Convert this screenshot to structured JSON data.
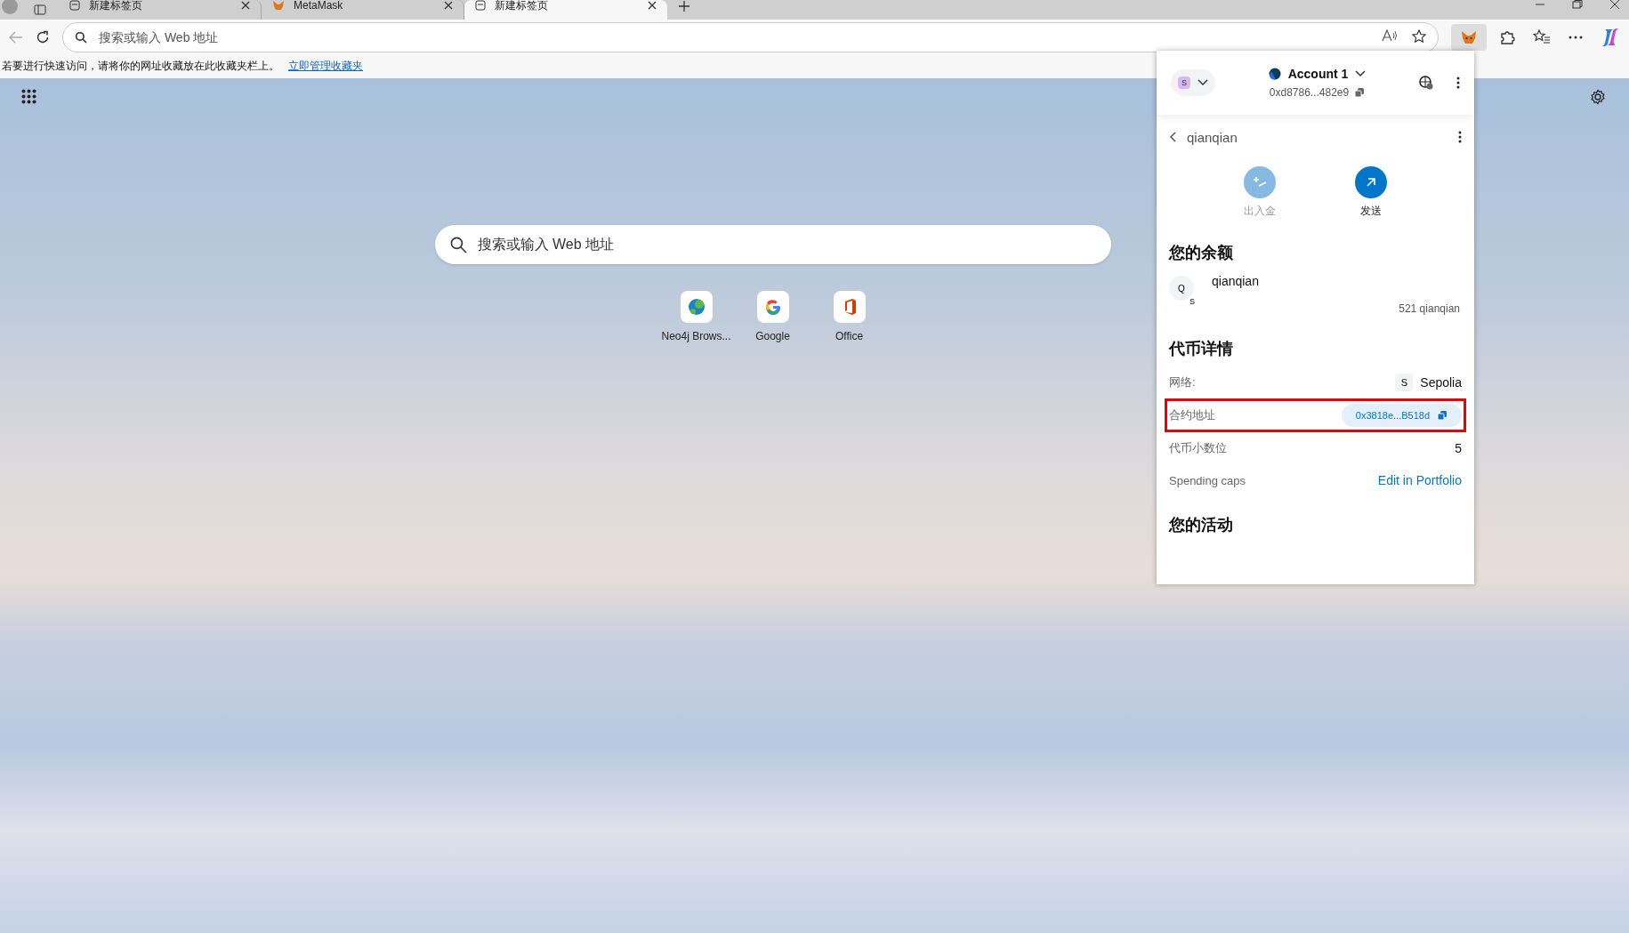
{
  "tabs": [
    {
      "title": "新建标签页",
      "kind": "page",
      "selected": false
    },
    {
      "title": "MetaMask",
      "kind": "metamask",
      "selected": false
    },
    {
      "title": "新建标签页",
      "kind": "page",
      "selected": true
    }
  ],
  "address_bar": {
    "placeholder": "搜索或输入 Web 地址"
  },
  "favorites_hint": {
    "text": "若要进行快速访问，请将你的网址收藏放在此收藏夹栏上。",
    "link": "立即管理收藏夹"
  },
  "new_tab": {
    "search": {
      "placeholder": "搜索或输入 Web 地址"
    },
    "shortcuts": [
      {
        "label": "Neo4j Brows...",
        "kind": "neo4j"
      },
      {
        "label": "Google",
        "kind": "google"
      },
      {
        "label": "Office",
        "kind": "office"
      }
    ]
  },
  "wallet": {
    "network_badge": "S",
    "account": "Account 1",
    "address": "0xd8786...482e9",
    "title": "qianqian",
    "token": {
      "name": "qianqian",
      "avatar": "Q",
      "avatar_badge": "S"
    },
    "actions": [
      {
        "label": "出入金",
        "kind": "buysell",
        "disabled": true
      },
      {
        "label": "发送",
        "kind": "send",
        "disabled": false
      }
    ],
    "balance_title": "您的余额",
    "balance_amount": "521 qianqian",
    "details_title": "代币详情",
    "details": [
      {
        "label": "网络:",
        "kind": "network",
        "badge": "S",
        "value": "Sepolia",
        "highlighted": false
      },
      {
        "label": "合约地址",
        "kind": "address",
        "value": "0x3818e...B518d",
        "highlighted": true
      },
      {
        "label": "代币小数位",
        "kind": "plain",
        "value": "5",
        "highlighted": false
      },
      {
        "label": "Spending caps",
        "kind": "link",
        "value": "Edit in Portfolio",
        "highlighted": false
      }
    ],
    "activity_title": "您的活动"
  }
}
